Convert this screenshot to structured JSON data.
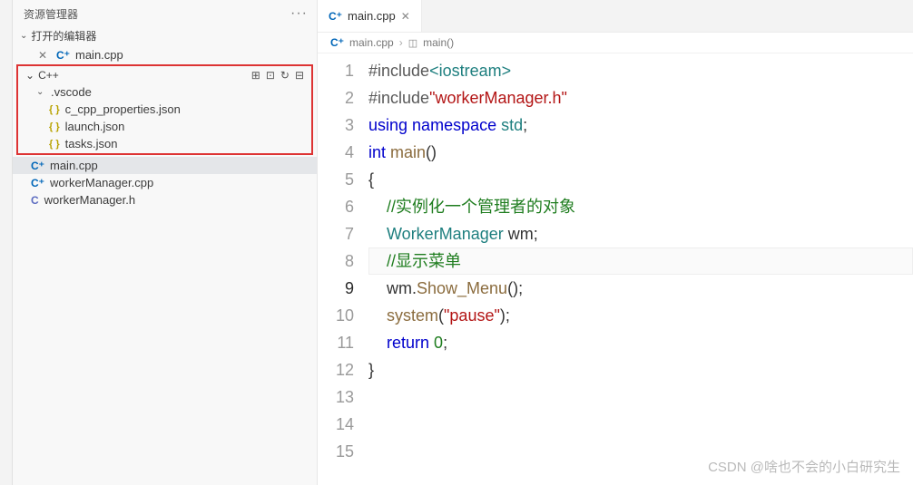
{
  "sidebar": {
    "title": "资源管理器",
    "open_editors_label": "打开的编辑器",
    "open_editors": [
      {
        "name": "main.cpp",
        "icon": "cpp"
      }
    ],
    "project_name": "C++",
    "toolbar_icons": [
      "new-file-icon",
      "new-folder-icon",
      "refresh-icon",
      "collapse-icon"
    ],
    "tree": {
      "folder": {
        "name": ".vscode",
        "expanded": true
      },
      "folder_files": [
        {
          "name": "c_cpp_properties.json",
          "icon": "json"
        },
        {
          "name": "launch.json",
          "icon": "json"
        },
        {
          "name": "tasks.json",
          "icon": "json"
        }
      ],
      "files": [
        {
          "name": "main.cpp",
          "icon": "cpp",
          "selected": true
        },
        {
          "name": "workerManager.cpp",
          "icon": "cpp"
        },
        {
          "name": "workerManager.h",
          "icon": "c"
        }
      ]
    }
  },
  "tab": {
    "name": "main.cpp",
    "icon": "cpp"
  },
  "breadcrumb": {
    "file": "main.cpp",
    "symbol": "main()"
  },
  "code": {
    "current_line": 9,
    "lines": [
      {
        "n": 1,
        "segs": [
          [
            "pp",
            "#include"
          ],
          [
            "ty",
            "<iostream>"
          ]
        ]
      },
      {
        "n": 2,
        "segs": [
          [
            "pp",
            "#include"
          ],
          [
            "str",
            "\"workerManager.h\""
          ]
        ]
      },
      {
        "n": 3,
        "segs": [
          [
            "kw",
            "using "
          ],
          [
            "kw",
            "namespace "
          ],
          [
            "ty",
            "std"
          ],
          [
            "",
            "; "
          ]
        ]
      },
      {
        "n": 4,
        "segs": [
          [
            "kw",
            "int "
          ],
          [
            "fn",
            "main"
          ],
          [
            "",
            "()"
          ]
        ]
      },
      {
        "n": 5,
        "segs": [
          [
            "",
            "{"
          ]
        ]
      },
      {
        "n": 6,
        "segs": [
          [
            "",
            "    "
          ],
          [
            "cm",
            "//实例化一个管理者的对象"
          ]
        ]
      },
      {
        "n": 7,
        "segs": [
          [
            "",
            "    "
          ],
          [
            "ty",
            "WorkerManager"
          ],
          [
            "",
            " wm;"
          ]
        ]
      },
      {
        "n": 8,
        "segs": [
          [
            "",
            ""
          ]
        ]
      },
      {
        "n": 9,
        "segs": [
          [
            "",
            "    "
          ],
          [
            "cm",
            "//显示菜单"
          ]
        ]
      },
      {
        "n": 10,
        "segs": [
          [
            "",
            "    wm."
          ],
          [
            "fn",
            "Show_Menu"
          ],
          [
            "",
            "();"
          ]
        ]
      },
      {
        "n": 11,
        "segs": [
          [
            "",
            ""
          ]
        ]
      },
      {
        "n": 12,
        "segs": [
          [
            "",
            "    "
          ],
          [
            "fn",
            "system"
          ],
          [
            "",
            "("
          ],
          [
            "str",
            "\"pause\""
          ],
          [
            "",
            ");"
          ]
        ]
      },
      {
        "n": 13,
        "segs": [
          [
            "",
            "    "
          ],
          [
            "kw",
            "return "
          ],
          [
            "num",
            "0"
          ],
          [
            "",
            ";"
          ]
        ]
      },
      {
        "n": 14,
        "segs": [
          [
            "",
            "}"
          ]
        ]
      },
      {
        "n": 15,
        "segs": [
          [
            "",
            ""
          ]
        ]
      }
    ]
  },
  "watermark": "CSDN @啥也不会的小白研究生"
}
